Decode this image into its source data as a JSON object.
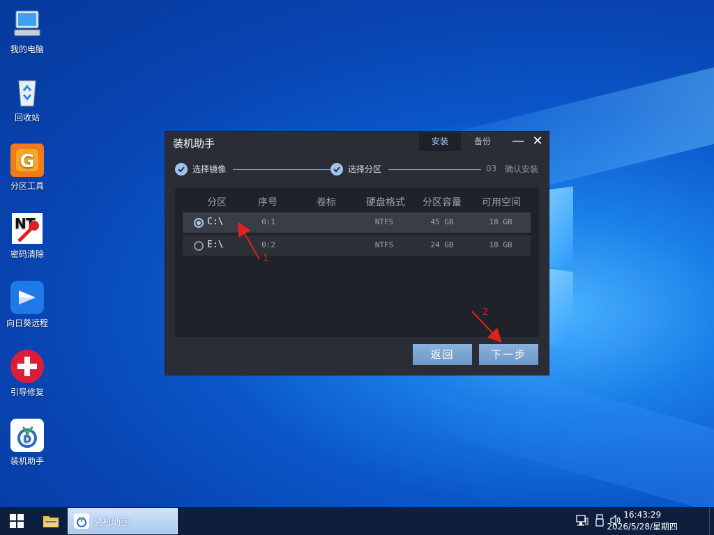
{
  "desktop": {
    "icons": [
      {
        "label": "我的电脑",
        "icon": "computer-icon"
      },
      {
        "label": "回收站",
        "icon": "recycle-bin-icon"
      },
      {
        "label": "分区工具",
        "icon": "partition-tool-icon"
      },
      {
        "label": "密码清除",
        "icon": "password-clear-icon"
      },
      {
        "label": "向日葵远程",
        "icon": "sunflower-remote-icon"
      },
      {
        "label": "引导修复",
        "icon": "boot-repair-icon"
      },
      {
        "label": "装机助手",
        "icon": "install-assistant-icon"
      }
    ]
  },
  "dialog": {
    "title": "装机助手",
    "tabs": {
      "install": "安装",
      "backup": "备份"
    },
    "minimize": "—",
    "close": "✕",
    "steps": [
      {
        "label": "选择镜像",
        "done": true
      },
      {
        "label": "选择分区",
        "done": true
      },
      {
        "num": "03",
        "label": "确认安装",
        "done": false
      }
    ],
    "table": {
      "headers": [
        "分区",
        "序号",
        "卷标",
        "硬盘格式",
        "分区容量",
        "可用空间"
      ],
      "rows": [
        {
          "drive": "C:\\",
          "index": "0:1",
          "label": "",
          "format": "NTFS",
          "size": "45 GB",
          "free": "18 GB",
          "selected": true
        },
        {
          "drive": "E:\\",
          "index": "0:2",
          "label": "",
          "format": "NTFS",
          "size": "24 GB",
          "free": "18 GB",
          "selected": false
        }
      ]
    },
    "buttons": {
      "back": "返回",
      "next": "下一步"
    },
    "annotations": [
      "1",
      "2"
    ]
  },
  "taskbar": {
    "app_label": "装机助手",
    "time": "16:43:29",
    "date": "2026/5/28/星期四"
  },
  "colors": {
    "annotation": "#e0231c",
    "accent": "#9ec4ee"
  }
}
